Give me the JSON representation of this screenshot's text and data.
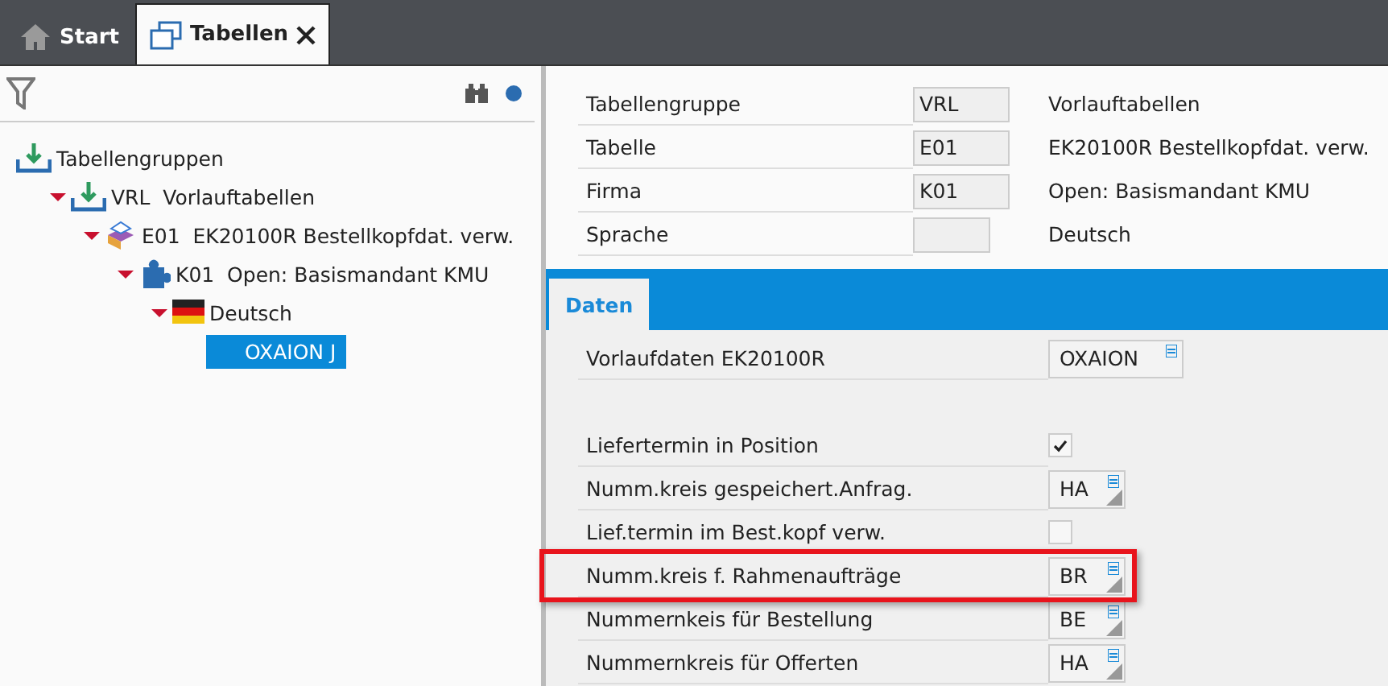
{
  "tabs": [
    {
      "label": "Start",
      "kind": "home",
      "selected": false,
      "closable": false
    },
    {
      "label": "Tabellen",
      "kind": "window",
      "selected": true,
      "closable": true
    }
  ],
  "tree": [
    {
      "label": "Tabellengruppen",
      "kind": "group",
      "selected": false,
      "children": [
        {
          "code": "VRL",
          "label": "Vorlauftabellen",
          "kind": "group",
          "expanded": true,
          "selected": false,
          "children": [
            {
              "code": "E01",
              "label": "EK20100R Bestellkopfdat. verw.",
              "kind": "table",
              "expanded": true,
              "selected": false,
              "children": [
                {
                  "code": "K01",
                  "label": "Open: Basismandant KMU",
                  "kind": "company",
                  "expanded": true,
                  "selected": false,
                  "children": [
                    {
                      "label": "Deutsch",
                      "kind": "language",
                      "expanded": true,
                      "selected": false,
                      "children": [
                        {
                          "label": "OXAION J",
                          "selected": true
                        }
                      ]
                    }
                  ]
                }
              ]
            }
          ]
        }
      ]
    }
  ],
  "header": [
    {
      "label": "Tabellengruppe",
      "value": "VRL",
      "description": "Vorlauftabellen"
    },
    {
      "label": "Tabelle",
      "value": "E01",
      "description": "EK20100R Bestellkopfdat. verw."
    },
    {
      "label": "Firma",
      "value": "K01",
      "description": "Open: Basismandant KMU"
    },
    {
      "label": "Sprache",
      "description": "Deutsch"
    }
  ],
  "section_tabs": [
    {
      "label": "Daten",
      "selected": true
    }
  ],
  "top_fields": [
    {
      "label": "Vorlaufdaten EK20100R",
      "kind": "combo",
      "value": "OXAION",
      "highlighted": false
    }
  ],
  "fields": [
    {
      "label": "Liefertermin in Position",
      "kind": "check",
      "checked": true,
      "highlighted": false
    },
    {
      "label": "Numm.kreis gespeichert.Anfrag.",
      "kind": "lookup",
      "value": "HA",
      "highlighted": false
    },
    {
      "label": "Lief.termin im Best.kopf verw.",
      "kind": "check",
      "checked": false,
      "highlighted": false
    },
    {
      "label": "Numm.kreis f. Rahmenaufträge",
      "kind": "lookup",
      "value": "BR",
      "highlighted": true
    },
    {
      "label": "Nummernkeis für Bestellung",
      "kind": "lookup",
      "value": "BE",
      "highlighted": false
    },
    {
      "label": "Nummernkreis für Offerten",
      "kind": "lookup",
      "value": "HA",
      "highlighted": false
    }
  ]
}
